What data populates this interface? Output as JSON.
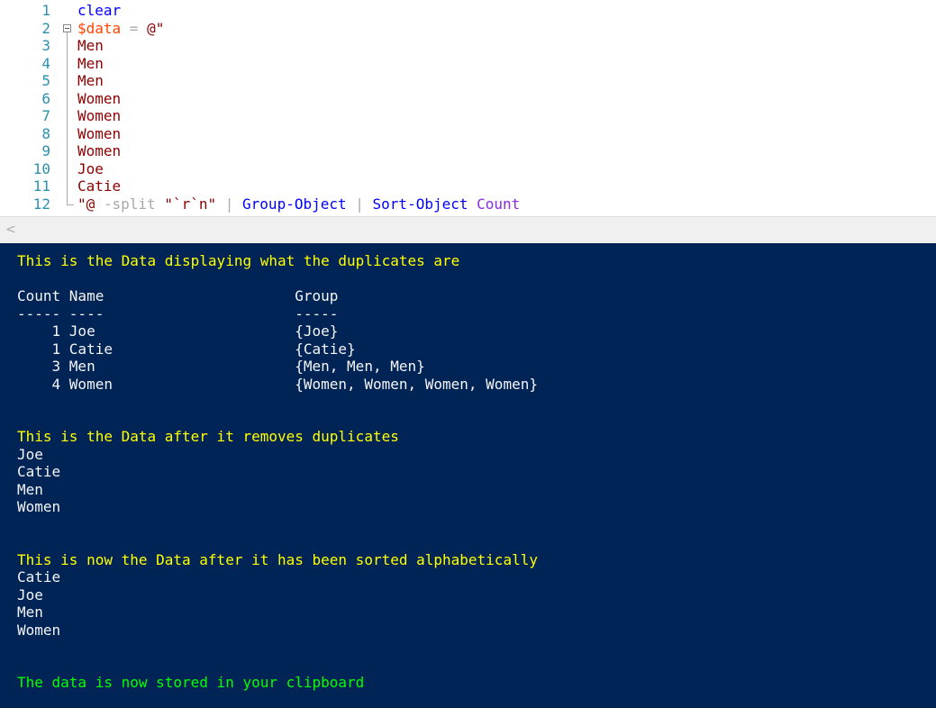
{
  "editor": {
    "lines": [
      {
        "num": "1",
        "tokens": [
          [
            "kw",
            "clear"
          ]
        ]
      },
      {
        "num": "2",
        "tokens": [
          [
            "var",
            "$data"
          ],
          [
            "op",
            " = "
          ],
          [
            "str",
            "@\""
          ]
        ]
      },
      {
        "num": "3",
        "tokens": [
          [
            "str",
            "Men"
          ]
        ]
      },
      {
        "num": "4",
        "tokens": [
          [
            "str",
            "Men"
          ]
        ]
      },
      {
        "num": "5",
        "tokens": [
          [
            "str",
            "Men"
          ]
        ]
      },
      {
        "num": "6",
        "tokens": [
          [
            "str",
            "Women"
          ]
        ]
      },
      {
        "num": "7",
        "tokens": [
          [
            "str",
            "Women"
          ]
        ]
      },
      {
        "num": "8",
        "tokens": [
          [
            "str",
            "Women"
          ]
        ]
      },
      {
        "num": "9",
        "tokens": [
          [
            "str",
            "Women"
          ]
        ]
      },
      {
        "num": "10",
        "tokens": [
          [
            "str",
            "Joe"
          ]
        ]
      },
      {
        "num": "11",
        "tokens": [
          [
            "str",
            "Catie"
          ]
        ]
      },
      {
        "num": "12",
        "tokens": [
          [
            "str",
            "\"@"
          ],
          [
            "op",
            " -split "
          ],
          [
            "str",
            "\"`r`n\""
          ],
          [
            "op",
            " | "
          ],
          [
            "cmd",
            "Group-Object"
          ],
          [
            "op",
            " | "
          ],
          [
            "cmd",
            "Sort-Object"
          ],
          [
            "op",
            " "
          ],
          [
            "arg",
            "Count"
          ]
        ]
      }
    ]
  },
  "scrollbar": {
    "left_arrow": "<"
  },
  "console": {
    "lines": [
      {
        "text": "This is the Data displaying what the duplicates are",
        "color": "yellow"
      },
      {
        "text": "",
        "color": "white"
      },
      {
        "text": "Count Name                      Group",
        "color": "white"
      },
      {
        "text": "----- ----                      -----",
        "color": "white"
      },
      {
        "text": "    1 Joe                       {Joe}",
        "color": "white"
      },
      {
        "text": "    1 Catie                     {Catie}",
        "color": "white"
      },
      {
        "text": "    3 Men                       {Men, Men, Men}",
        "color": "white"
      },
      {
        "text": "    4 Women                     {Women, Women, Women, Women}",
        "color": "white"
      },
      {
        "text": "",
        "color": "white"
      },
      {
        "text": "",
        "color": "white"
      },
      {
        "text": "This is the Data after it removes duplicates",
        "color": "yellow"
      },
      {
        "text": "Joe",
        "color": "white"
      },
      {
        "text": "Catie",
        "color": "white"
      },
      {
        "text": "Men",
        "color": "white"
      },
      {
        "text": "Women",
        "color": "white"
      },
      {
        "text": "",
        "color": "white"
      },
      {
        "text": "",
        "color": "white"
      },
      {
        "text": "This is now the Data after it has been sorted alphabetically",
        "color": "yellow"
      },
      {
        "text": "Catie",
        "color": "white"
      },
      {
        "text": "Joe",
        "color": "white"
      },
      {
        "text": "Men",
        "color": "white"
      },
      {
        "text": "Women",
        "color": "white"
      },
      {
        "text": "",
        "color": "white"
      },
      {
        "text": "",
        "color": "white"
      },
      {
        "text": "The data is now stored in your clipboard",
        "color": "green"
      }
    ]
  },
  "colors": {
    "console_bg": "#012456",
    "console_text": "#f5f5f5",
    "console_yellow": "#ffff00",
    "console_green": "#00ff00",
    "line_number": "#2b91af",
    "keyword": "#0000ff",
    "variable": "#ff4500",
    "string": "#8b0000",
    "operator": "#a9a9a9",
    "argument": "#8a2be2"
  }
}
